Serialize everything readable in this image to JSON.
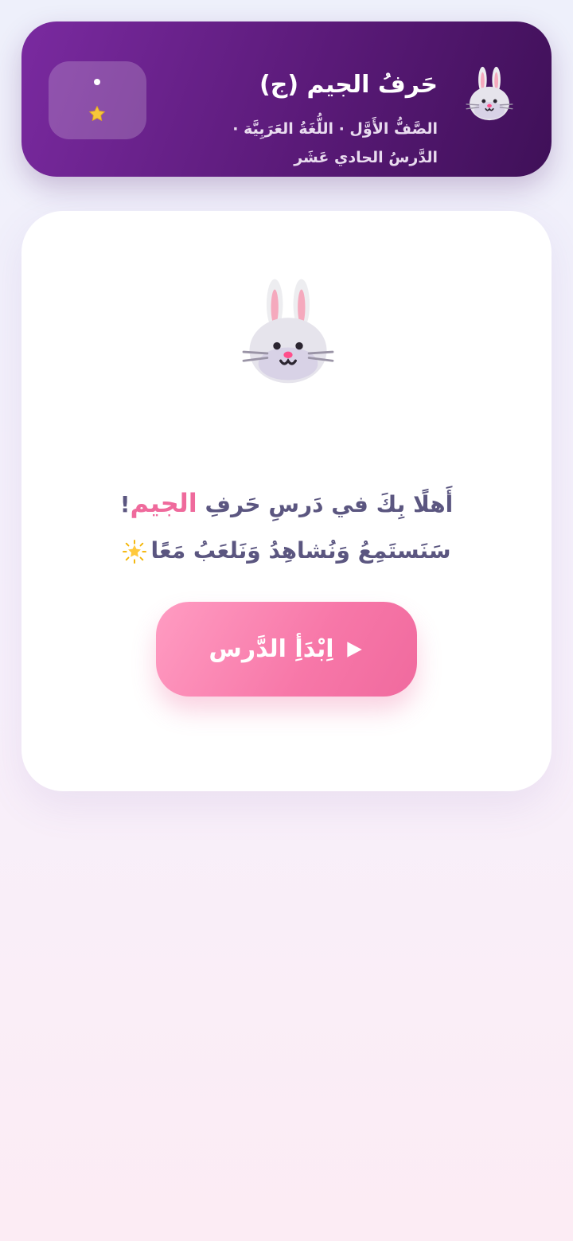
{
  "header": {
    "title": "حَرفُ الجيم (ج)",
    "subtitle": "الصَّفُّ الأَوَّل · اللُّغَةُ العَرَبِيَّة · الدَّرسُ الحادي عَشَر",
    "avatar_icon": "bunny-icon",
    "score": {
      "star_icon": "star-icon"
    }
  },
  "welcome": {
    "prefix": "أَهلًا بِكَ في دَرسِ حَرفِ",
    "accent": "الجيم",
    "suffix": "!",
    "line2": "سَنَستَمِعُ وَنُشاهِدُ وَنَلعَبُ مَعًا",
    "sparkle_icon": "sparkle-star-icon",
    "mascot_icon": "bunny-icon"
  },
  "start_button": {
    "label": "اِبْدَأِ الدَّرس",
    "icon": "play-icon"
  },
  "colors": {
    "header_start": "#7a2aa0",
    "header_end": "#3f1058",
    "accent_pink": "#ef6a9c",
    "text": "#5b5680"
  }
}
